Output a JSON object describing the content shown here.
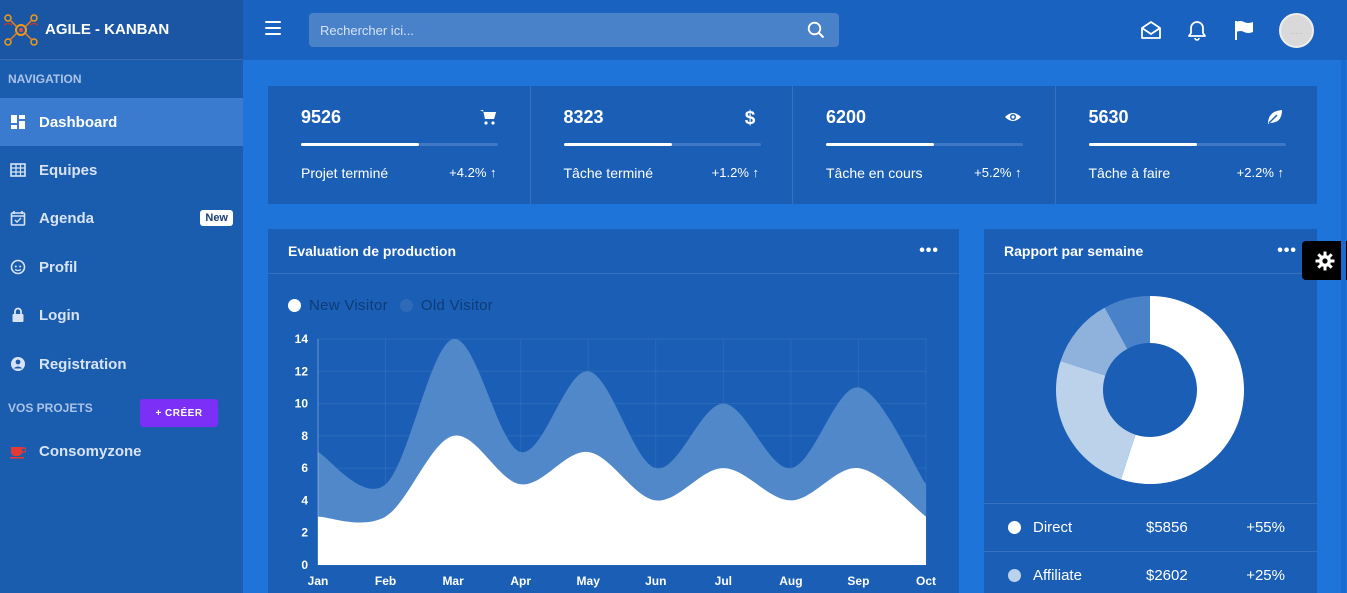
{
  "brand": {
    "title": "AGILE - KANBAN"
  },
  "sidebar": {
    "nav_heading": "NAVIGATION",
    "items": [
      {
        "label": "Dashboard",
        "icon": "dashboard-icon",
        "active": true
      },
      {
        "label": "Equipes",
        "icon": "table-icon"
      },
      {
        "label": "Agenda",
        "icon": "calendar-icon",
        "badge": "New"
      },
      {
        "label": "Profil",
        "icon": "face-icon"
      },
      {
        "label": "Login",
        "icon": "lock-icon"
      },
      {
        "label": "Registration",
        "icon": "user-circle-icon"
      }
    ],
    "projects_heading": "VOS PROJETS",
    "create_label": "+ CRÉER",
    "projects": [
      {
        "label": "Consomyzone",
        "icon": "coffee-icon",
        "icon_color": "#e53935"
      }
    ]
  },
  "topbar": {
    "search_placeholder": "Rechercher ici...",
    "icons": [
      "mail-open-icon",
      "bell-icon",
      "flag-icon"
    ],
    "avatar_text": "....."
  },
  "stats": [
    {
      "value": "9526",
      "label": "Projet terminé",
      "change": "+4.2% ↑",
      "icon": "cart-icon",
      "progress": 0.6
    },
    {
      "value": "8323",
      "label": "Tâche terminé",
      "change": "+1.2% ↑",
      "icon": "dollar-icon",
      "progress": 0.55
    },
    {
      "value": "6200",
      "label": "Tâche en cours",
      "change": "+5.2% ↑",
      "icon": "eye-icon",
      "progress": 0.55
    },
    {
      "value": "5630",
      "label": "Tâche à faire",
      "change": "+2.2% ↑",
      "icon": "leaf-icon",
      "progress": 0.55
    }
  ],
  "production": {
    "title": "Evaluation de production",
    "menu": "•••"
  },
  "report": {
    "title": "Rapport par semaine",
    "menu": "•••",
    "rows": [
      {
        "name": "Direct",
        "amount": "$5856",
        "pct": "+55%",
        "color": "#ffffff"
      },
      {
        "name": "Affiliate",
        "amount": "$2602",
        "pct": "+25%",
        "color": "#bcd1ea"
      }
    ]
  },
  "colors": {
    "new_visitor": "#ffffff",
    "old_visitor": "#5b8fcc",
    "accent_purple": "#7b2ff7"
  },
  "chart_data": [
    {
      "type": "area",
      "categories": [
        "Jan",
        "Feb",
        "Mar",
        "Apr",
        "May",
        "Jun",
        "Jul",
        "Aug",
        "Sep",
        "Oct"
      ],
      "ylim": [
        0,
        14
      ],
      "yticks": [
        "0",
        "2",
        "4",
        "6",
        "8",
        "10",
        "12",
        "14"
      ],
      "legend_position": "top-left",
      "grid": true,
      "series": [
        {
          "name": "New Visitor",
          "color": "#ffffff",
          "values": [
            3,
            3,
            8,
            5,
            7,
            4,
            6,
            4,
            6,
            3
          ]
        },
        {
          "name": "Old Visitor",
          "color": "#5b8fcc",
          "values": [
            7,
            5,
            14,
            7,
            12,
            6,
            10,
            6,
            11,
            5
          ]
        }
      ]
    },
    {
      "type": "pie",
      "donut": true,
      "slices": [
        {
          "value": 55,
          "color": "#ffffff"
        },
        {
          "value": 25,
          "color": "#bcd1ea"
        },
        {
          "value": 12,
          "color": "#8fb2dd"
        },
        {
          "value": 8,
          "color": "#4a82c9"
        }
      ]
    }
  ]
}
